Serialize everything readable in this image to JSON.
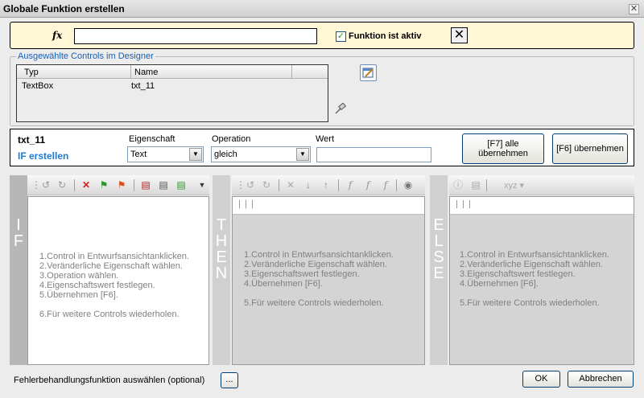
{
  "window": {
    "title": "Globale Funktion erstellen",
    "close_glyph": "✕"
  },
  "formula": {
    "fx_label": "fx",
    "value": "",
    "active_checked": true,
    "active_label": "Funktion ist aktiv",
    "clear_glyph": "✕"
  },
  "designer_group": {
    "legend": "Ausgewählte Controls im Designer",
    "columns": [
      "Typ",
      "Name"
    ],
    "rows": [
      {
        "type": "TextBox",
        "name": "txt_11"
      }
    ]
  },
  "condition": {
    "control_name": "txt_11",
    "mode_label": "IF erstellen",
    "property_label": "Eigenschaft",
    "property_value": "Text",
    "operation_label": "Operation",
    "operation_value": "gleich",
    "value_label": "Wert",
    "value": "",
    "apply_all_label": "[F7] alle übernehmen",
    "apply_label": "[F6] übernehmen"
  },
  "panes": {
    "if": {
      "letters": [
        "I",
        "F"
      ]
    },
    "then": {
      "letters": [
        "T",
        "H",
        "E",
        "N"
      ]
    },
    "else": {
      "letters": [
        "E",
        "L",
        "S",
        "E"
      ]
    },
    "hint_lines": [
      "1.Control in Entwurfsansichtanklicken.",
      "2.Veränderliche Eigenschaft wählen.",
      "3.Operation wählen.",
      "4.Eigenschaftswert festlegen.",
      "5.Übernehmen [F6]."
    ],
    "hint_lines_then": [
      "1.Control in Entwurfsansichtanklicken.",
      "2.Veränderliche Eigenschaft wählen.",
      "3.Eigenschaftswert festlegen.",
      "4.Übernehmen [F6]."
    ],
    "hint_repeat_if": "6.Für weitere Controls wiederholen.",
    "hint_repeat_then": "5.Für weitere Controls wiederholen.",
    "xyz_label": "xyz"
  },
  "footer": {
    "error_label": "Fehlerbehandlungsfunktion auswählen (optional)",
    "dots_label": "...",
    "ok_label": "OK",
    "cancel_label": "Abbrechen"
  },
  "colors": {
    "accent_blue": "#1a7bd8",
    "fx_bar": "#fff7d6",
    "delete_red": "#d32020"
  }
}
